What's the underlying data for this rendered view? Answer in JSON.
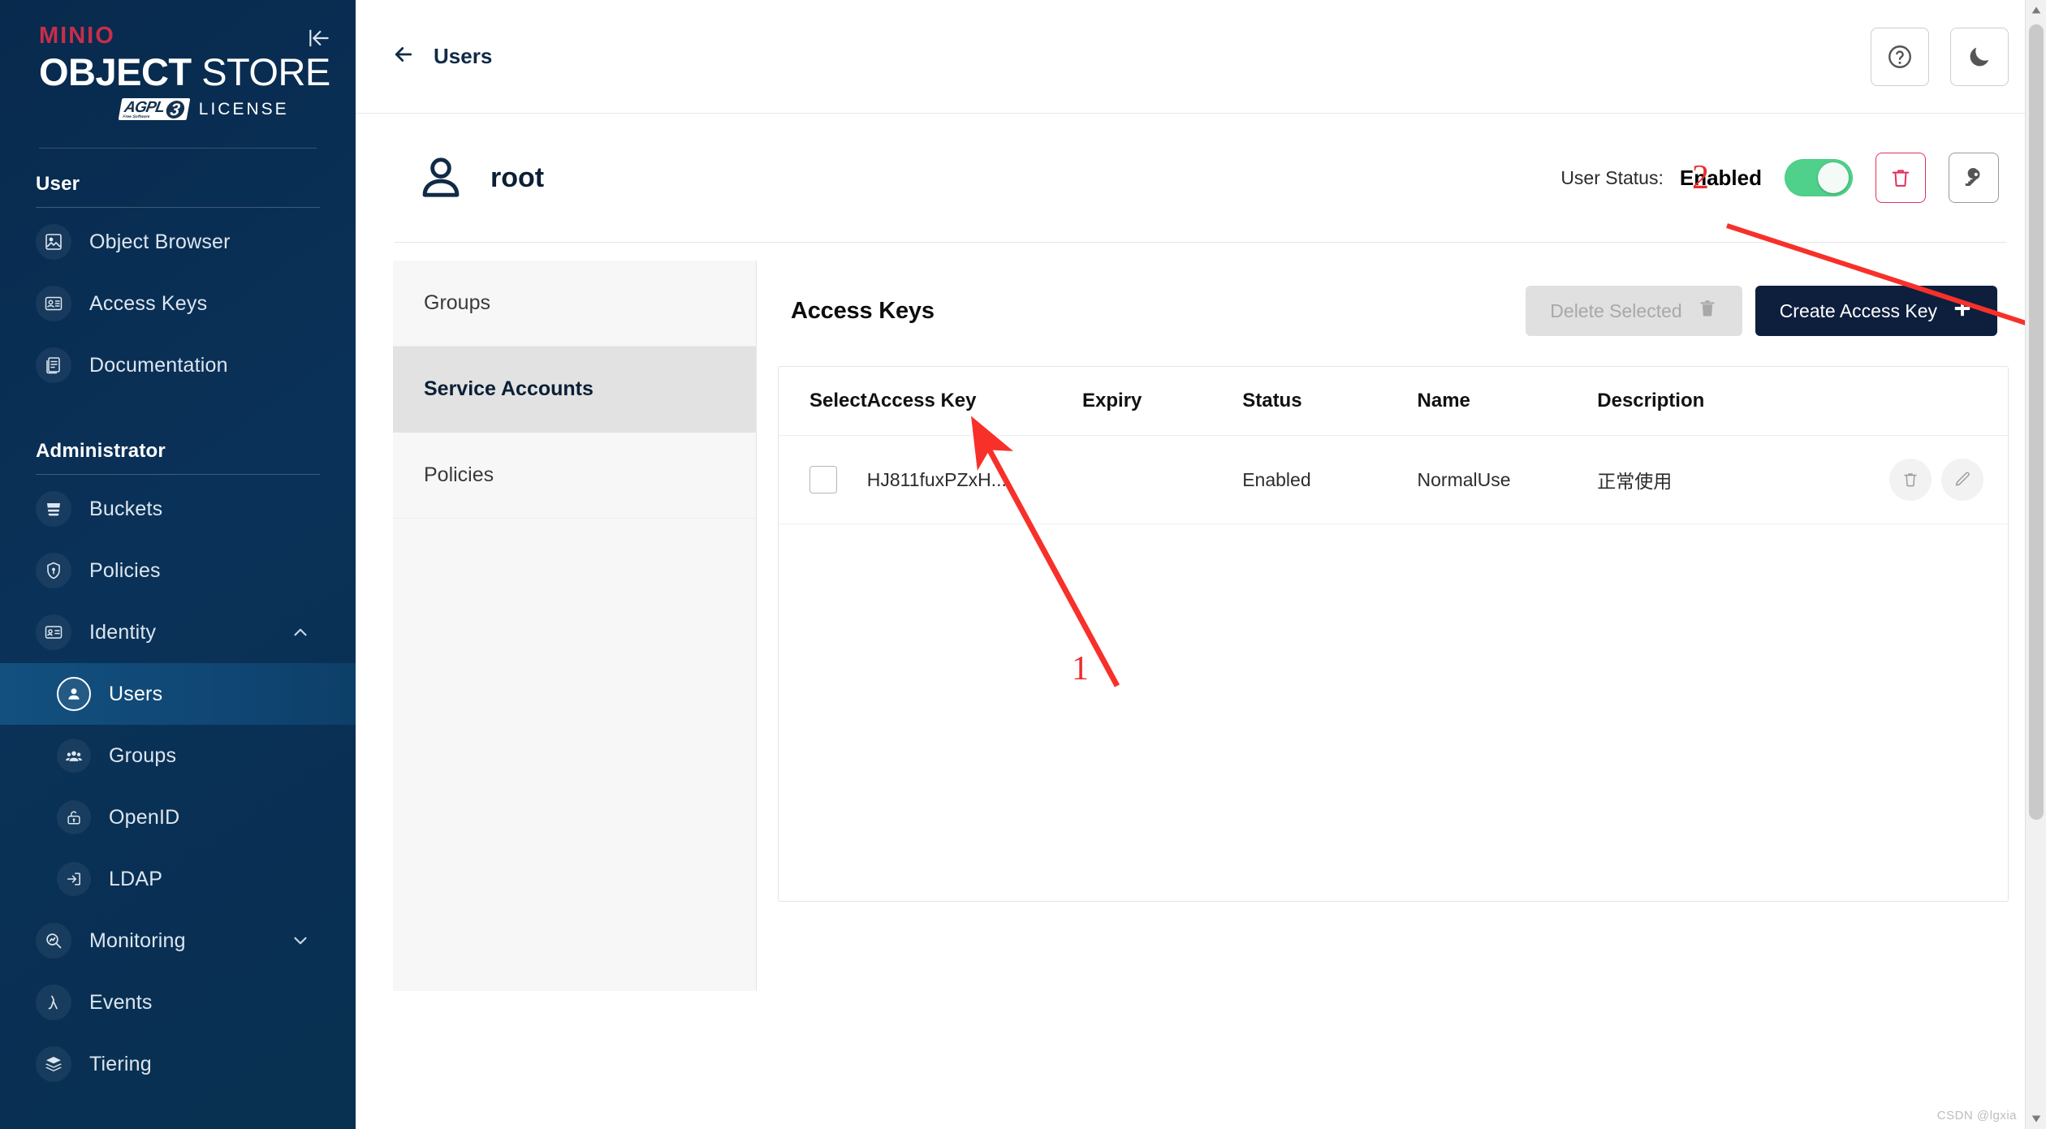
{
  "brand": {
    "minio": "MINIO",
    "product_bold": "OBJECT",
    "product_light": "STORE",
    "agpl": "AGPL",
    "agpl_sub": "Free Software",
    "agpl_version": "3",
    "license": "LICENSE"
  },
  "sidebar": {
    "collapse_icon": "collapse-sidebar-icon",
    "sections": [
      {
        "label": "User",
        "items": [
          {
            "label": "Object Browser",
            "icon": "object-browser-icon"
          },
          {
            "label": "Access Keys",
            "icon": "access-keys-icon"
          },
          {
            "label": "Documentation",
            "icon": "documentation-icon"
          }
        ]
      },
      {
        "label": "Administrator",
        "items": [
          {
            "label": "Buckets",
            "icon": "bucket-icon"
          },
          {
            "label": "Policies",
            "icon": "policy-lock-icon"
          },
          {
            "label": "Identity",
            "icon": "identity-card-icon",
            "expanded": true,
            "chevron": "chevron-up-icon"
          },
          {
            "label": "Users",
            "icon": "user-icon",
            "sub": true,
            "active": true
          },
          {
            "label": "Groups",
            "icon": "groups-icon",
            "sub": true
          },
          {
            "label": "OpenID",
            "icon": "openid-lock-icon",
            "sub": true
          },
          {
            "label": "LDAP",
            "icon": "ldap-login-icon",
            "sub": true
          },
          {
            "label": "Monitoring",
            "icon": "monitoring-icon",
            "chevron": "chevron-down-icon"
          },
          {
            "label": "Events",
            "icon": "lambda-icon"
          },
          {
            "label": "Tiering",
            "icon": "tiering-layers-icon"
          }
        ]
      }
    ]
  },
  "topbar": {
    "back_icon": "back-arrow-icon",
    "breadcrumb": "Users",
    "help_icon": "help-circle-icon",
    "theme_icon": "dark-mode-moon-icon"
  },
  "user": {
    "avatar_icon": "user-avatar-icon",
    "name": "root",
    "status_label": "User Status:",
    "status_value": "Enabled",
    "status_enabled": true,
    "delete_icon": "trash-icon",
    "key_icon": "key-icon"
  },
  "tabs": [
    {
      "label": "Groups",
      "active": false
    },
    {
      "label": "Service Accounts",
      "active": true
    },
    {
      "label": "Policies",
      "active": false
    }
  ],
  "access_keys": {
    "title": "Access Keys",
    "delete_selected_label": "Delete Selected",
    "delete_selected_icon": "trash-icon",
    "create_label": "Create Access Key",
    "create_icon": "plus-icon",
    "columns": [
      "Select",
      "Access Key",
      "Expiry",
      "Status",
      "Name",
      "Description"
    ],
    "rows": [
      {
        "selected": false,
        "access_key": "HJ811fuxPZxH...",
        "expiry": "",
        "status": "Enabled",
        "name": "NormalUse",
        "description": "正常使用",
        "row_delete_icon": "trash-icon",
        "row_edit_icon": "pencil-edit-icon"
      }
    ]
  },
  "annotations": [
    {
      "number": "1",
      "color": "#ee2b2b",
      "target": "service-accounts-tab"
    },
    {
      "number": "2",
      "color": "#ee2b2b",
      "target": "create-access-key-button"
    }
  ],
  "watermark": "CSDN @lgxia",
  "colors": {
    "sidebar_bg": "#0a3158",
    "brand_red": "#c72e49",
    "navy": "#0d1f3d",
    "toggle_green": "#4fd18b",
    "danger_red": "#e0315b",
    "annotation_red": "#ee2b2b"
  }
}
